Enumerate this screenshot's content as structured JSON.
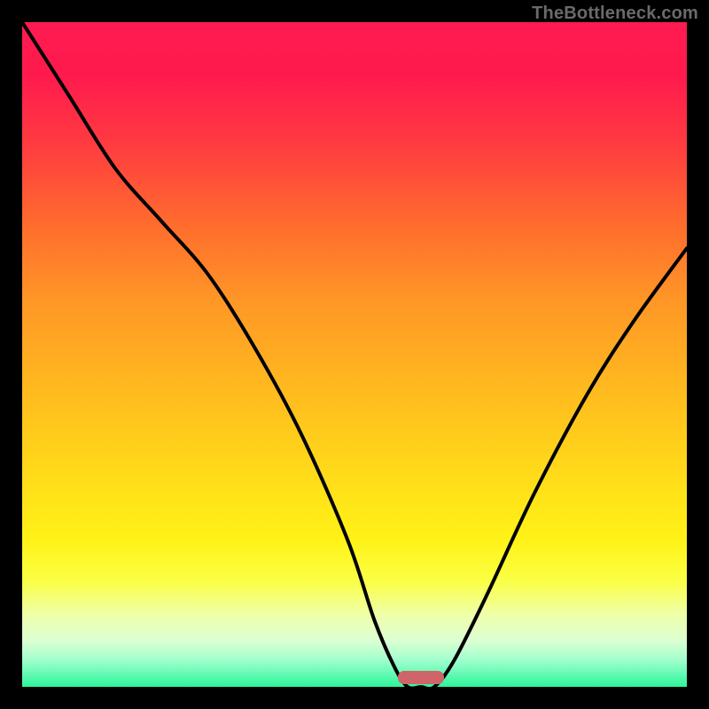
{
  "watermark": "TheBottleneck.com",
  "colors": {
    "frame_bg": "#000000",
    "marker": "#cf6569",
    "curve": "#000000",
    "watermark_text": "#6a6a6a",
    "gradient_top": "#ff1a51",
    "gradient_bottom": "#2cf59a"
  },
  "chart_data": {
    "type": "line",
    "title": "",
    "xlabel": "",
    "ylabel": "",
    "xlim": [
      0,
      100
    ],
    "ylim": [
      0,
      100
    ],
    "grid": false,
    "legend_position": "none",
    "annotations": [
      "watermark: TheBottleneck.com"
    ],
    "series": [
      {
        "name": "bottleneck-curve",
        "x": [
          0,
          7,
          14,
          21,
          28,
          35,
          42,
          49,
          53,
          56,
          58,
          60,
          62,
          65,
          70,
          77,
          85,
          92,
          100
        ],
        "values": [
          100,
          89,
          78,
          70,
          62,
          51,
          38,
          22,
          10,
          3,
          0,
          0,
          0,
          4,
          14,
          29,
          44,
          55,
          66
        ]
      }
    ],
    "marker": {
      "x_center": 60,
      "width_pct": 7,
      "color": "#cf6569"
    }
  }
}
